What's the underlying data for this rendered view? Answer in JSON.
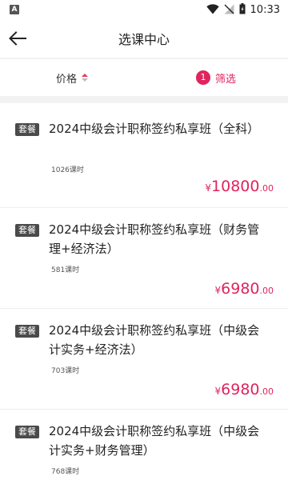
{
  "status_bar": {
    "left_icon_letter": "A",
    "time": "10:33",
    "icons": [
      "wifi-icon",
      "signal-off-icon",
      "battery-icon"
    ]
  },
  "header": {
    "title": "选课中心",
    "back_icon": "arrow-left-icon"
  },
  "filter_bar": {
    "price_label": "价格",
    "filter_count": "1",
    "filter_label": "筛选"
  },
  "colors": {
    "accent": "#e0245e",
    "badge_bg": "#4a4a4a"
  },
  "courses": [
    {
      "badge": "套餐",
      "title": "2024中级会计职称签约私享班（全科）",
      "hours": "1026课时",
      "price_symbol": "¥",
      "price_int": "10800",
      "price_dec": ".00"
    },
    {
      "badge": "套餐",
      "title": "2024中级会计职称签约私享班（财务管理+经济法）",
      "hours": "581课时",
      "price_symbol": "¥",
      "price_int": "6980",
      "price_dec": ".00"
    },
    {
      "badge": "套餐",
      "title": "2024中级会计职称签约私享班（中级会计实务+经济法）",
      "hours": "703课时",
      "price_symbol": "¥",
      "price_int": "6980",
      "price_dec": ".00"
    },
    {
      "badge": "套餐",
      "title": "2024中级会计职称签约私享班（中级会计实务+财务管理）",
      "hours": "768课时",
      "price_symbol": "¥",
      "price_int": "",
      "price_dec": ""
    }
  ]
}
